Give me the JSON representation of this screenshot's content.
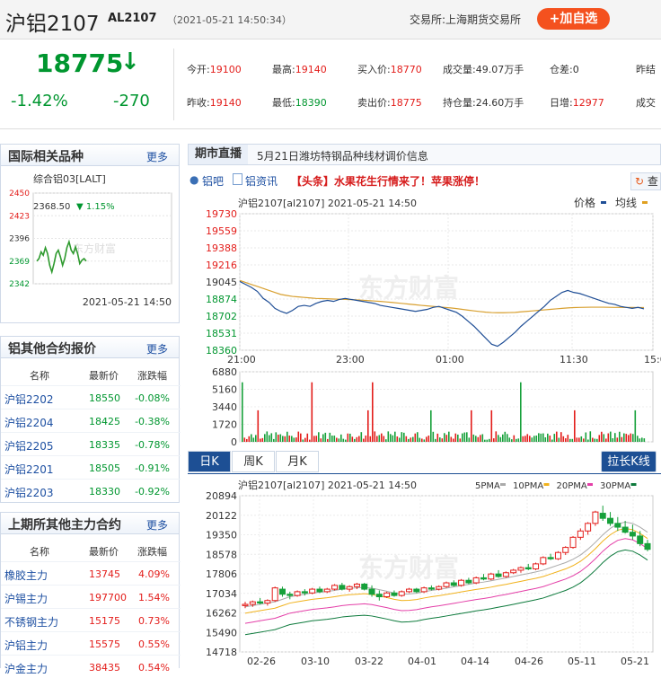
{
  "header": {
    "title": "沪铝2107",
    "code": "AL2107",
    "time": "（2021-05-21 14:50:34）",
    "exchange": "交易所:上海期货交易所",
    "add_button": "+加自选"
  },
  "quote": {
    "price": "18775",
    "arrow": "↓",
    "change_pct": "-1.42%",
    "change": "-270",
    "fields": [
      {
        "label": "今开:",
        "value": "19100",
        "color": "#e31d1a"
      },
      {
        "label": "最高:",
        "value": "19140",
        "color": "#e31d1a"
      },
      {
        "label": "买入价:",
        "value": "18770",
        "color": "#e31d1a"
      },
      {
        "label": "成交量:",
        "value": "49.07万手",
        "color": "#333"
      },
      {
        "label": "仓差:",
        "value": "0",
        "color": "#333"
      },
      {
        "label": "昨结",
        "value": "",
        "color": "#333"
      },
      {
        "label": "昨收:",
        "value": "19140",
        "color": "#e31d1a"
      },
      {
        "label": "最低:",
        "value": "18390",
        "color": "#00962f"
      },
      {
        "label": "卖出价:",
        "value": "18775",
        "color": "#e31d1a"
      },
      {
        "label": "持仓量:",
        "value": "24.60万手",
        "color": "#333"
      },
      {
        "label": "日增:",
        "value": "12977",
        "color": "#e31d1a"
      },
      {
        "label": "成交",
        "value": "",
        "color": "#333"
      }
    ]
  },
  "intl": {
    "title": "国际相关品种",
    "more": "更多",
    "name": "综合铝03[LALT]",
    "price": "2368.50",
    "chg": "▼ 1.15%",
    "y_ticks": [
      "2450",
      "2423",
      "2396",
      "2369",
      "2342"
    ],
    "time": "2021-05-21 14:50",
    "watermark": "东方财富",
    "chart_data": {
      "type": "line",
      "y_range": [
        2342,
        2450
      ],
      "values": [
        2369,
        2372,
        2380,
        2376,
        2385,
        2378,
        2364,
        2356,
        2366,
        2378,
        2382,
        2374,
        2364,
        2372,
        2385,
        2392,
        2382,
        2378,
        2386,
        2378,
        2366,
        2370,
        2372,
        2369
      ]
    }
  },
  "others": {
    "title": "铝其他合约报价",
    "more": "更多",
    "headers": [
      "名称",
      "最新价",
      "涨跌幅"
    ],
    "rows": [
      [
        "沪铝2202",
        "18550",
        "-0.08%"
      ],
      [
        "沪铝2204",
        "18425",
        "-0.38%"
      ],
      [
        "沪铝2205",
        "18335",
        "-0.78%"
      ],
      [
        "沪铝2201",
        "18505",
        "-0.91%"
      ],
      [
        "沪铝2203",
        "18330",
        "-0.92%"
      ]
    ]
  },
  "main": {
    "title": "上期所其他主力合约",
    "more": "更多",
    "headers": [
      "名称",
      "最新价",
      "涨跌幅"
    ],
    "rows": [
      [
        "橡胶主力",
        "13745",
        "4.09%"
      ],
      [
        "沪锡主力",
        "197700",
        "1.54%"
      ],
      [
        "不锈钢主力",
        "15175",
        "0.73%"
      ],
      [
        "沪铝主力",
        "15575",
        "0.55%"
      ],
      [
        "沪金主力",
        "38435",
        "0.54%"
      ]
    ]
  },
  "news": {
    "label": "期市直播",
    "text": "5月21日潍坊特钢品种线材调价信息"
  },
  "links": {
    "forum": "铝吧",
    "info": "铝资讯",
    "headline": "【头条】水果花生行情来了！苹果涨停！",
    "refresh": "查"
  },
  "intraday": {
    "title": "沪铝2107[al2107] 2021-05-21 14:50",
    "legend_price": "价格",
    "legend_avg": "均线",
    "y_ticks": [
      "19730",
      "19559",
      "19388",
      "19216",
      "19045",
      "18874",
      "18702",
      "18531",
      "18360"
    ],
    "x_ticks": [
      "21:00",
      "23:00",
      "01:00",
      "11:30",
      "15:00"
    ],
    "vol_ticks": [
      "6880",
      "5160",
      "3440",
      "1720",
      "0"
    ],
    "watermark": "东方财富",
    "chart_data": {
      "type": "line",
      "y_range": [
        18360,
        19730
      ],
      "price": [
        19050,
        19020,
        18990,
        18950,
        18880,
        18840,
        18780,
        18750,
        18730,
        18760,
        18800,
        18810,
        18800,
        18830,
        18850,
        18860,
        18850,
        18870,
        18880,
        18870,
        18860,
        18850,
        18840,
        18830,
        18810,
        18800,
        18790,
        18780,
        18770,
        18760,
        18750,
        18760,
        18770,
        18790,
        18800,
        18780,
        18760,
        18740,
        18700,
        18650,
        18600,
        18540,
        18480,
        18420,
        18400,
        18440,
        18490,
        18540,
        18600,
        18650,
        18700,
        18750,
        18800,
        18860,
        18900,
        18940,
        18960,
        18940,
        18930,
        18910,
        18890,
        18870,
        18850,
        18830,
        18820,
        18800,
        18790,
        18780,
        18790,
        18775
      ],
      "avg": [
        19060,
        19040,
        19020,
        19000,
        18980,
        18960,
        18940,
        18920,
        18910,
        18900,
        18895,
        18890,
        18885,
        18880,
        18878,
        18876,
        18874,
        18872,
        18870,
        18868,
        18865,
        18862,
        18858,
        18854,
        18850,
        18845,
        18840,
        18834,
        18828,
        18822,
        18816,
        18810,
        18805,
        18800,
        18795,
        18790,
        18785,
        18778,
        18770,
        18762,
        18755,
        18748,
        18742,
        18738,
        18736,
        18736,
        18738,
        18740,
        18745,
        18750,
        18755,
        18760,
        18765,
        18770,
        18775,
        18780,
        18785,
        18788,
        18790,
        18791,
        18792,
        18792,
        18792,
        18791,
        18790,
        18790,
        18789,
        18789,
        18788,
        18788
      ]
    }
  },
  "kline": {
    "tabs": [
      "日K",
      "周K",
      "月K"
    ],
    "button": "拉长K线",
    "title": "沪铝2107[al2107] 2021-05-21 14:50",
    "legend": [
      {
        "name": "5PMA",
        "color": "#aaaaaa"
      },
      {
        "name": "10PMA",
        "color": "#f1b21c"
      },
      {
        "name": "20PMA",
        "color": "#e43fa8"
      },
      {
        "name": "30PMA",
        "color": "#0d7a3c"
      }
    ],
    "y_ticks": [
      "20894",
      "20122",
      "19350",
      "18578",
      "17806",
      "17034",
      "16262",
      "15490",
      "14718"
    ],
    "x_ticks": [
      "02-26",
      "03-10",
      "03-22",
      "04-01",
      "04-14",
      "04-26",
      "05-11",
      "05-21"
    ],
    "watermark": "东方财富",
    "chart_data": {
      "type": "candlestick",
      "y_range": [
        14718,
        20894
      ],
      "ohlc": [
        [
          16550,
          16700,
          16450,
          16600
        ],
        [
          16600,
          16750,
          16500,
          16700
        ],
        [
          16700,
          16850,
          16600,
          16650
        ],
        [
          16650,
          16800,
          16550,
          16750
        ],
        [
          16750,
          17300,
          16700,
          17250
        ],
        [
          17200,
          17300,
          16900,
          17000
        ],
        [
          17000,
          17100,
          16800,
          16950
        ],
        [
          16950,
          17150,
          16900,
          17100
        ],
        [
          17100,
          17200,
          16950,
          17050
        ],
        [
          17050,
          17250,
          17000,
          17200
        ],
        [
          17200,
          17300,
          17050,
          17100
        ],
        [
          17100,
          17250,
          17050,
          17200
        ],
        [
          17200,
          17400,
          17150,
          17350
        ],
        [
          17350,
          17450,
          17150,
          17200
        ],
        [
          17200,
          17350,
          17100,
          17300
        ],
        [
          17300,
          17450,
          17200,
          17400
        ],
        [
          17400,
          17450,
          17150,
          17200
        ],
        [
          17200,
          17350,
          16900,
          17000
        ],
        [
          17000,
          17150,
          16750,
          16900
        ],
        [
          16900,
          17100,
          16850,
          17050
        ],
        [
          17050,
          17150,
          16900,
          16950
        ],
        [
          16950,
          17150,
          16900,
          17100
        ],
        [
          17100,
          17250,
          17050,
          17200
        ],
        [
          17200,
          17250,
          17050,
          17100
        ],
        [
          17100,
          17300,
          17050,
          17250
        ],
        [
          17250,
          17350,
          17150,
          17200
        ],
        [
          17200,
          17350,
          17150,
          17300
        ],
        [
          17300,
          17500,
          17250,
          17450
        ],
        [
          17450,
          17550,
          17300,
          17350
        ],
        [
          17350,
          17600,
          17300,
          17550
        ],
        [
          17550,
          17650,
          17400,
          17450
        ],
        [
          17450,
          17700,
          17400,
          17650
        ],
        [
          17650,
          17800,
          17550,
          17600
        ],
        [
          17600,
          17850,
          17550,
          17800
        ],
        [
          17800,
          17950,
          17650,
          17700
        ],
        [
          17700,
          17900,
          17650,
          17850
        ],
        [
          17850,
          18000,
          17800,
          17950
        ],
        [
          17950,
          18100,
          17850,
          18050
        ],
        [
          18050,
          18200,
          17950,
          18000
        ],
        [
          18000,
          18250,
          17950,
          18200
        ],
        [
          18200,
          18500,
          18150,
          18450
        ],
        [
          18450,
          18600,
          18350,
          18400
        ],
        [
          18400,
          18700,
          18350,
          18650
        ],
        [
          18650,
          18900,
          18550,
          18850
        ],
        [
          18850,
          19300,
          18800,
          19250
        ],
        [
          19250,
          19600,
          19150,
          19500
        ],
        [
          19500,
          19850,
          19350,
          19800
        ],
        [
          19800,
          20300,
          19700,
          20250
        ],
        [
          20200,
          20500,
          19900,
          20000
        ],
        [
          20000,
          20250,
          19700,
          19800
        ],
        [
          19800,
          20050,
          19500,
          19650
        ],
        [
          19650,
          19900,
          19400,
          19450
        ],
        [
          19450,
          19750,
          19150,
          19300
        ],
        [
          19300,
          19500,
          18900,
          19000
        ],
        [
          19000,
          19150,
          18700,
          18775
        ]
      ],
      "ma5": [
        16500,
        16550,
        16600,
        16650,
        16700,
        16800,
        16900,
        16950,
        17000,
        17050,
        17080,
        17110,
        17150,
        17200,
        17230,
        17250,
        17270,
        17240,
        17180,
        17120,
        17050,
        17000,
        17010,
        17040,
        17100,
        17150,
        17190,
        17240,
        17290,
        17340,
        17390,
        17440,
        17480,
        17530,
        17590,
        17640,
        17700,
        17760,
        17820,
        17880,
        17950,
        18050,
        18150,
        18250,
        18380,
        18550,
        18780,
        19050,
        19350,
        19600,
        19780,
        19850,
        19800,
        19650,
        19450
      ]
    }
  }
}
